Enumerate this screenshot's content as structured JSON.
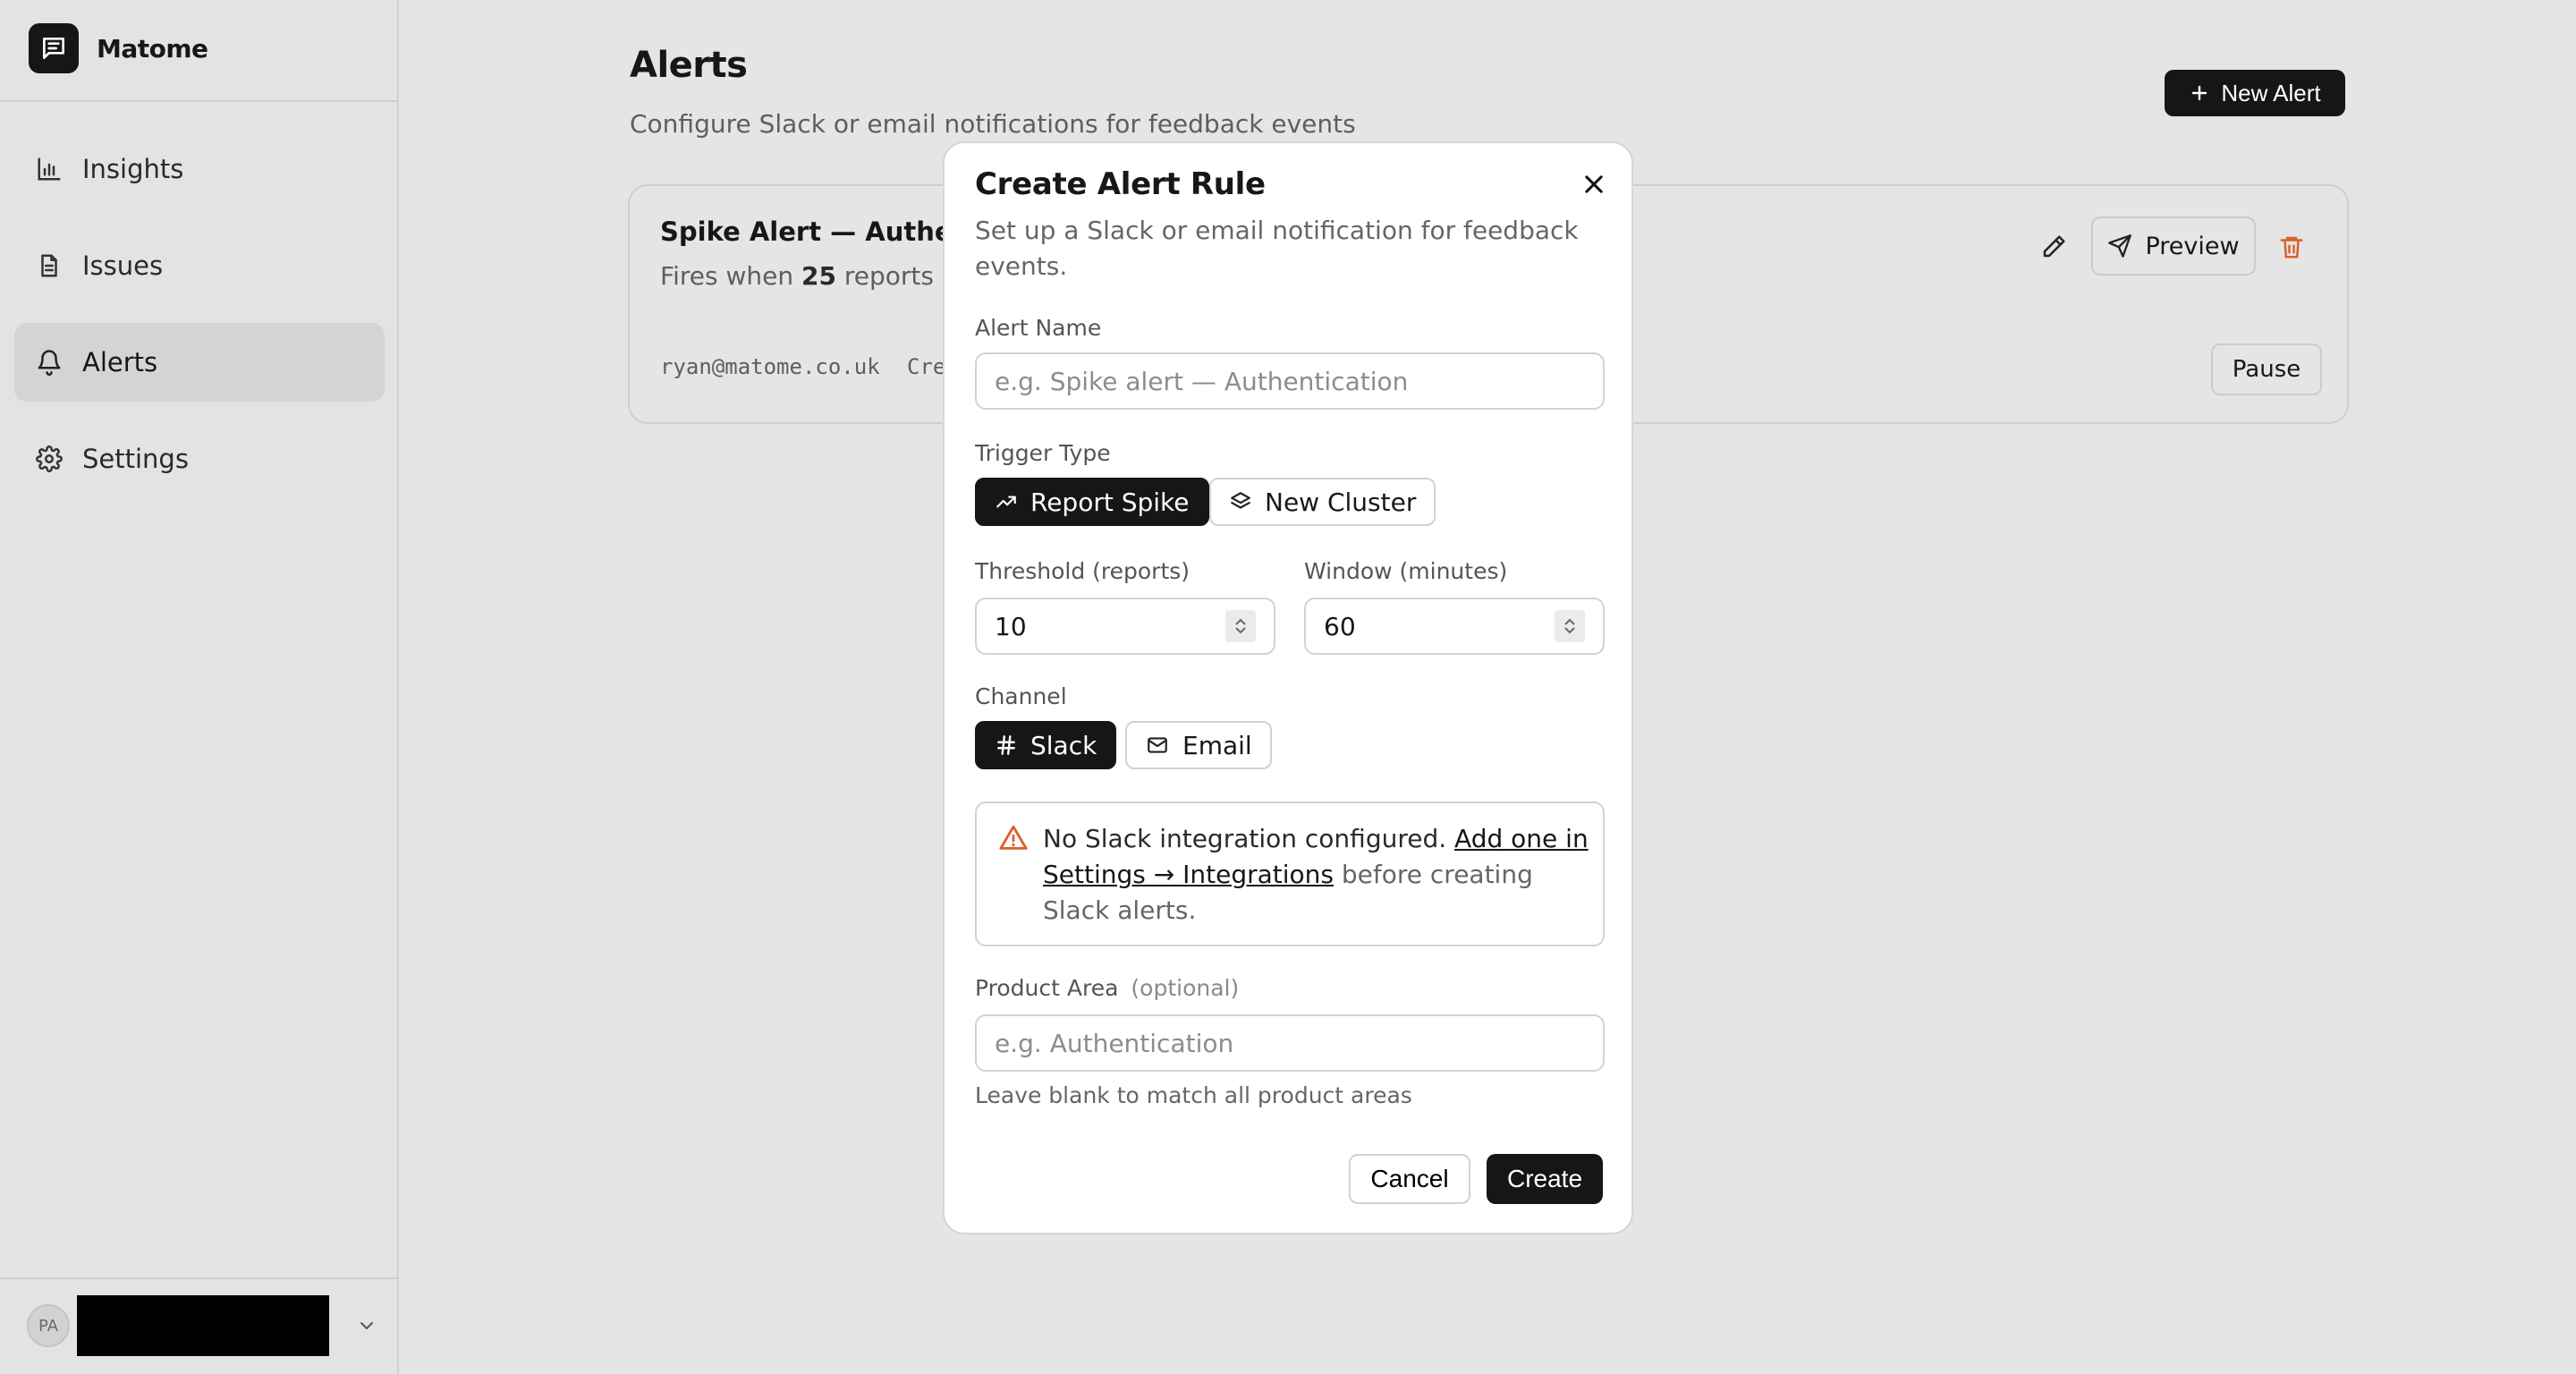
{
  "brand": {
    "name": "Matome"
  },
  "sidebar": {
    "items": [
      {
        "label": "Insights",
        "icon": "chart-icon"
      },
      {
        "label": "Issues",
        "icon": "document-icon"
      },
      {
        "label": "Alerts",
        "icon": "bell-icon",
        "active": true
      },
      {
        "label": "Settings",
        "icon": "gear-icon"
      }
    ],
    "user": {
      "initials": "PA"
    }
  },
  "page": {
    "title": "Alerts",
    "subtitle": "Configure Slack or email notifications for feedback events",
    "new_alert_label": "New Alert"
  },
  "alert_card": {
    "title": "Spike Alert — Authentic",
    "desc_prefix": "Fires when ",
    "desc_count": "25",
    "desc_suffix": " reports a",
    "email": "ryan@matome.co.uk",
    "created": "Cre",
    "preview_label": "Preview",
    "pause_label": "Pause"
  },
  "modal": {
    "title": "Create Alert Rule",
    "description": "Set up a Slack or email notification for feedback events.",
    "alert_name_label": "Alert Name",
    "alert_name_placeholder": "e.g. Spike alert — Authentication",
    "trigger_type_label": "Trigger Type",
    "trigger_options": [
      "Report Spike",
      "New Cluster"
    ],
    "trigger_selected": "Report Spike",
    "threshold_label": "Threshold (reports)",
    "threshold_value": "10",
    "window_label": "Window (minutes)",
    "window_value": "60",
    "channel_label": "Channel",
    "channel_options": [
      "Slack",
      "Email"
    ],
    "channel_selected": "Slack",
    "warning_strong": "No Slack integration configured.",
    "warning_link": "Add one in Settings → Integrations",
    "warning_suffix": " before creating Slack alerts.",
    "product_area_label": "Product Area",
    "product_area_optional": "(optional)",
    "product_area_placeholder": "e.g. Authentication",
    "product_area_hint": "Leave blank to match all product areas",
    "cancel_label": "Cancel",
    "create_label": "Create"
  },
  "colors": {
    "accent": "#161616",
    "warning": "#d9622b",
    "danger": "#d9622b",
    "background": "#e5e5e5"
  }
}
